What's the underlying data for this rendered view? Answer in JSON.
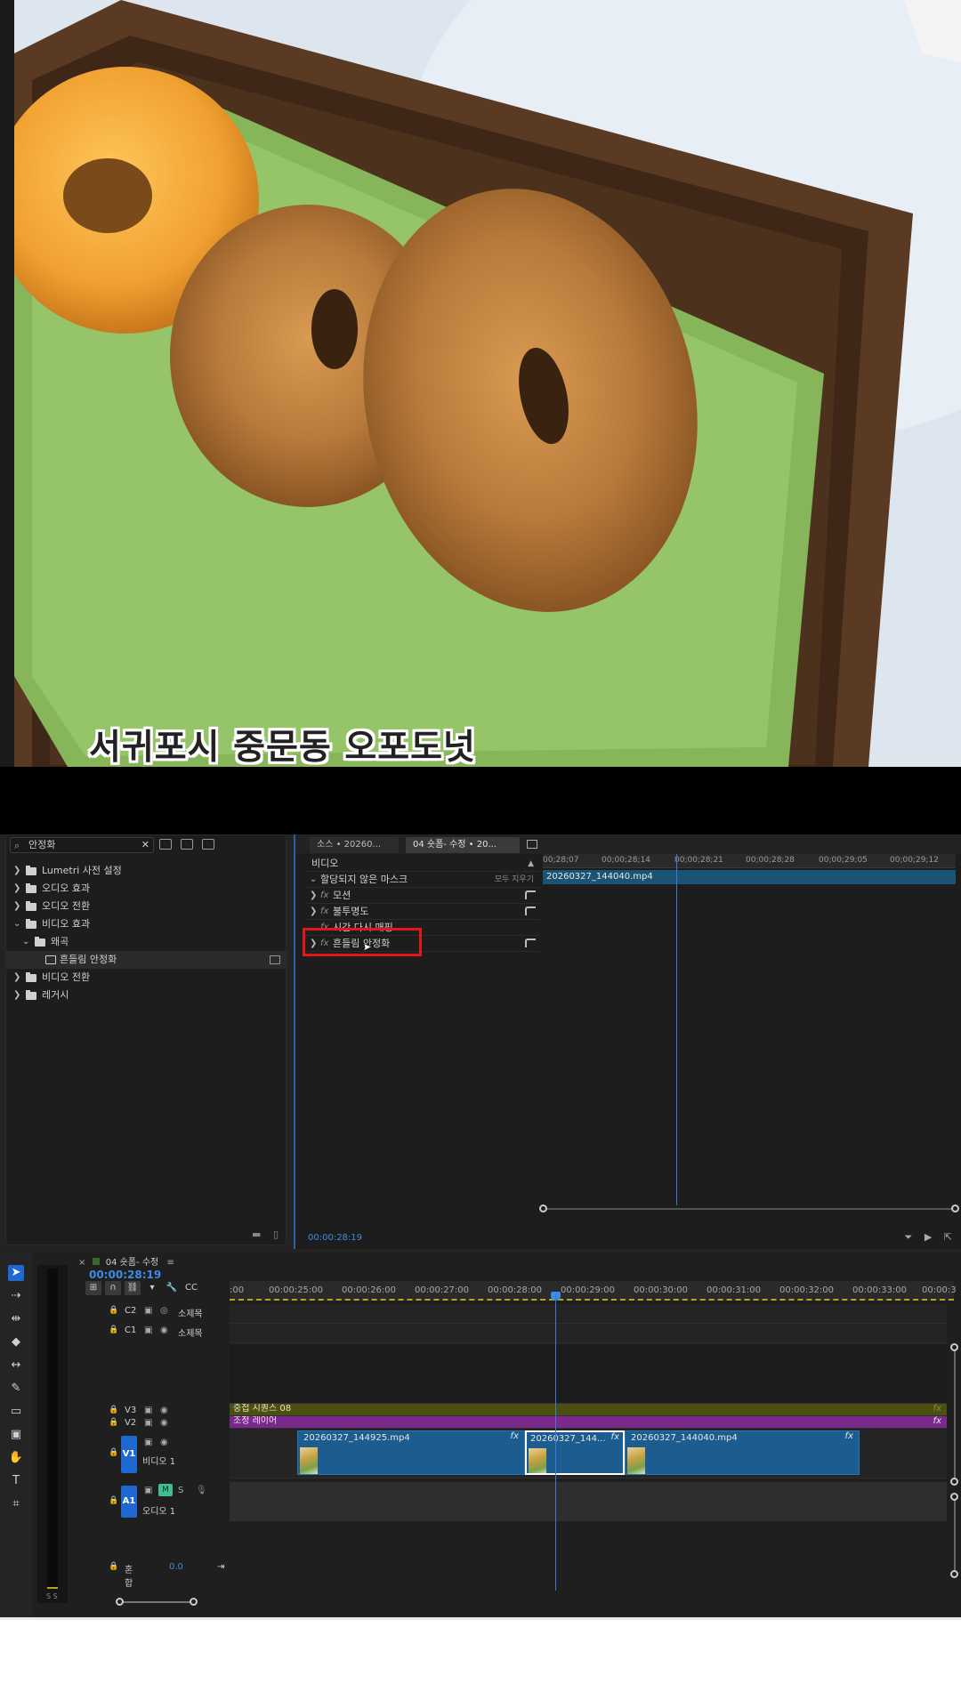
{
  "preview": {
    "caption": "서귀포시 중문동 오포도넛"
  },
  "effects_panel": {
    "search_value": "안정화",
    "tree": [
      {
        "label": "Lumetri 사전 설정",
        "expanded": false,
        "depth": 0
      },
      {
        "label": "오디오 효과",
        "expanded": false,
        "depth": 0
      },
      {
        "label": "오디오 전환",
        "expanded": false,
        "depth": 0
      },
      {
        "label": "비디오 효과",
        "expanded": true,
        "depth": 0
      },
      {
        "label": "왜곡",
        "expanded": true,
        "depth": 1
      },
      {
        "label": "흔들림 안정화",
        "depth": 2,
        "selected": true
      },
      {
        "label": "비디오 전환",
        "expanded": false,
        "depth": 0
      },
      {
        "label": "레거시",
        "expanded": false,
        "depth": 0
      }
    ]
  },
  "effect_controls": {
    "tab_source": "소스 • 20260...",
    "tab_sequence": "04 숏폼- 수정 • 20...",
    "section_video": "비디오",
    "mask_label": "할당되지 않은 마스크",
    "clear_all": "모두 지우기",
    "rows": [
      {
        "label": "모션"
      },
      {
        "label": "불투명도"
      },
      {
        "label": "시간 다시 매핑"
      },
      {
        "label": "흔들림 안정화"
      }
    ],
    "ruler_ticks": [
      "00;28;07",
      "00;00;28;14",
      "00;00;28;21",
      "00;00;28;28",
      "00;00;29;05",
      "00;00;29;12"
    ],
    "clip_name": "20260327_144040.mp4",
    "timecode": "00:00:28:19"
  },
  "timeline": {
    "sequence_name": "04 숏폼- 수정",
    "timecode": "00:00:28:19",
    "ruler_ticks": [
      ":00",
      "00:00:25:00",
      "00:00:26:00",
      "00:00:27:00",
      "00:00:28:00",
      "00:00:29:00",
      "00:00:30:00",
      "00:00:31:00",
      "00:00:32:00",
      "00:00:33:00",
      "00:00:3"
    ],
    "tracks": {
      "c2": {
        "tag": "C2",
        "name": "소제목"
      },
      "c1": {
        "tag": "C1",
        "name": "소제목"
      },
      "v3": {
        "tag": "V3"
      },
      "v2": {
        "tag": "V2"
      },
      "v1": {
        "tag": "V1",
        "name": "비디오 1"
      },
      "a1": {
        "tag": "A1",
        "name": "오디오 1"
      }
    },
    "clips": {
      "v3": "중첩 시퀀스 08",
      "v2": "조정 레이어",
      "v1": [
        "20260327_144925.mp4",
        "20260327_144...",
        "20260327_144040.mp4"
      ]
    },
    "mix": {
      "label": "혼합",
      "value": "0.0"
    },
    "meter_label": "S S"
  },
  "colors": {
    "accent": "#2d5ea8",
    "playhead": "#3c7ad6",
    "highlight": "#e1171c",
    "clip_video": "#1d5c8e",
    "clip_adjust": "#7a2a8c",
    "clip_nested": "#4b4f10"
  }
}
